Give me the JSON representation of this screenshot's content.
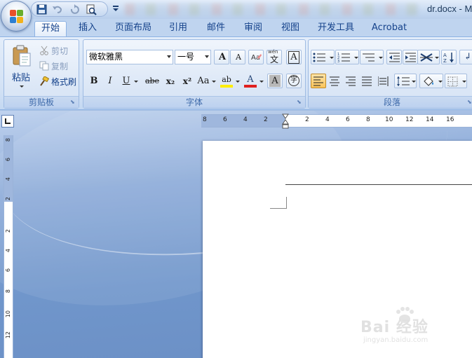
{
  "title_bar": {
    "doc_title": "dr.docx - M"
  },
  "tabs": [
    "开始",
    "插入",
    "页面布局",
    "引用",
    "邮件",
    "审阅",
    "视图",
    "开发工具",
    "Acrobat"
  ],
  "active_tab_index": 0,
  "clipboard": {
    "paste_label": "粘贴",
    "cut_label": "剪切",
    "copy_label": "复制",
    "format_painter_label": "格式刷",
    "group_label": "剪贴板"
  },
  "font": {
    "font_name": "微软雅黑",
    "font_size": "一号",
    "grow_glyph": "A",
    "shrink_glyph": "A",
    "phonetic_glyph": "wén",
    "phonetic_char": "文",
    "bold_glyph": "B",
    "italic_glyph": "I",
    "underline_glyph": "U",
    "strike_glyph": "abe",
    "subscript_glyph": "x₂",
    "superscript_glyph": "x²",
    "case_glyph": "Aa",
    "highlight_glyph": "ab",
    "color_glyph": "A",
    "shade_glyph": "A",
    "enclose_glyph": "字",
    "group_label": "字体"
  },
  "paragraph": {
    "group_label": "段落"
  },
  "ruler": {
    "h_labels": [
      "8",
      "6",
      "4",
      "2",
      "2",
      "4",
      "6",
      "8",
      "10",
      "12",
      "14",
      "16"
    ],
    "v_labels": [
      "8",
      "6",
      "4",
      "2",
      "2",
      "4",
      "6",
      "8",
      "10",
      "12"
    ]
  },
  "watermark": {
    "text": "Bai 经验",
    "url": "jingyan.baidu.com"
  },
  "colors": {
    "highlight": "#ffee00",
    "font_color": "#e02020",
    "accent": "#15428b"
  }
}
